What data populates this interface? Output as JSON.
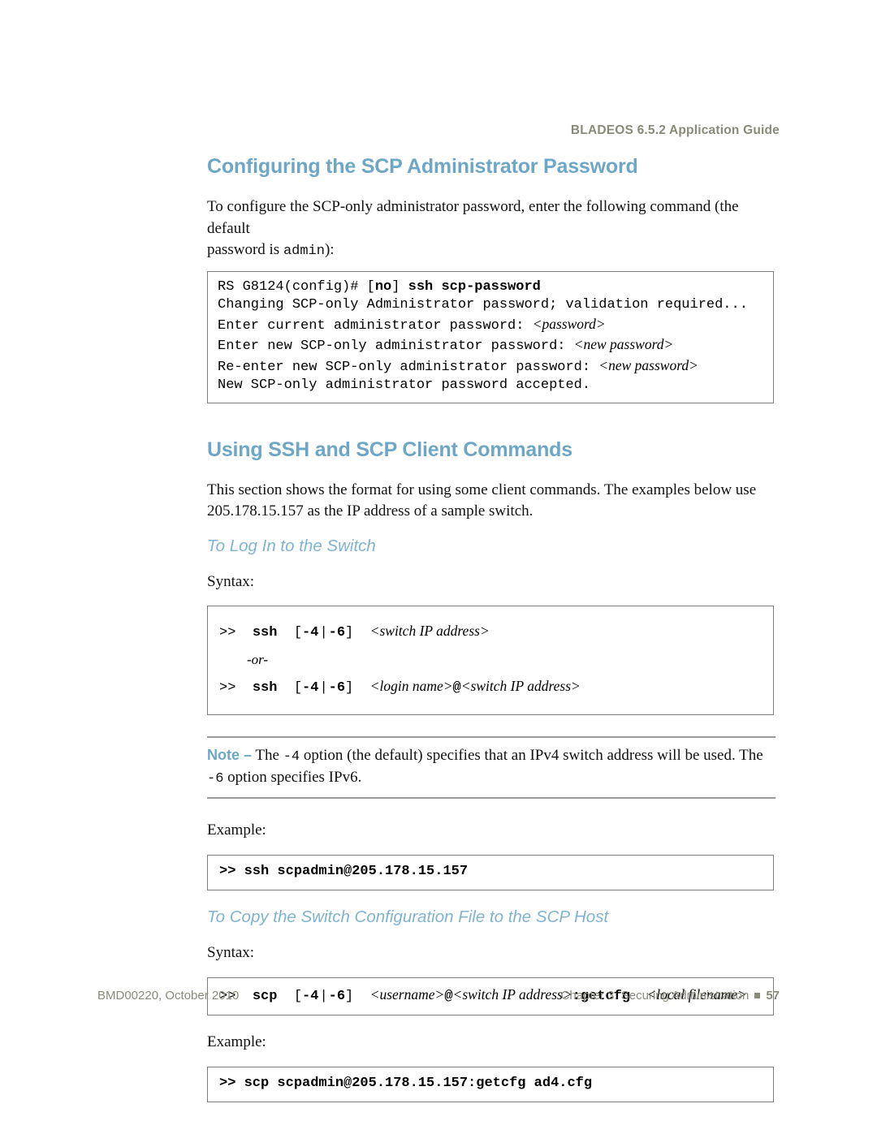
{
  "header": {
    "running_head": "BLADEOS 6.5.2 Application Guide"
  },
  "sections": [
    {
      "title": "Configuring the SCP Administrator Password",
      "intro_line1": "To configure the SCP-only administrator password, enter the following command (the default",
      "intro_line2_pre": "password is ",
      "intro_line2_mono": "admin",
      "intro_line2_post": "):",
      "console": {
        "line1_prompt": "RS G8124(config)# [",
        "line1_no": "no",
        "line1_bracket": "] ",
        "line1_cmd": "ssh scp-password",
        "line2": "Changing SCP-only Administrator password; validation required...",
        "line3_label": "Enter current administrator password: ",
        "line3_var": "<password>",
        "line4_label": "Enter new SCP-only administrator password: ",
        "line4_var": "<new password>",
        "line5_label": "Re-enter new SCP-only administrator password: ",
        "line5_var": "<new password>",
        "line6": "New SCP-only administrator password accepted."
      }
    },
    {
      "title": "Using SSH and SCP Client Commands",
      "intro_line1": "This section shows the format for using some client commands. The examples below use",
      "intro_line2": "205.178.15.157 as the IP address of a sample switch."
    }
  ],
  "subsections": [
    {
      "title": "To Log In to the Switch",
      "syntax_label": "Syntax:",
      "syntax_box": {
        "line1_prompt": ">>",
        "line1_cmd": "ssh",
        "line1_opt_open": "[",
        "line1_opt_4": "-4",
        "line1_opt_pipe": "|",
        "line1_opt_6": "-6",
        "line1_opt_close": "]",
        "line1_var": "<switch IP address>",
        "or_text": "-or-",
        "line3_prompt": ">>",
        "line3_cmd": "ssh",
        "line3_var_login": "<login name>",
        "line3_at": "@",
        "line3_var_addr": "<switch IP address>"
      },
      "note": {
        "label": "Note –",
        "text_a": " The ",
        "opt_4": "-4",
        "text_b": " option (the default) specifies that an IPv4 switch address will be used. The ",
        "opt_6": "-6",
        "text_c": " option specifies IPv6."
      },
      "example_label": "Example:",
      "example_code": ">> ssh scpadmin@205.178.15.157"
    },
    {
      "title": "To Copy the Switch Configuration File to the SCP Host",
      "syntax_label": "Syntax:",
      "syntax_box": {
        "prompt": ">>",
        "cmd": "scp",
        "opt_open": "[",
        "opt_4": "-4",
        "opt_pipe": "|",
        "opt_6": "-6",
        "opt_close": "]",
        "var_user": "<username>",
        "at": "@",
        "var_addr": "<switch IP address>",
        "colon_getcfg": ":getcfg",
        "var_file": "<local filename>"
      },
      "example_label": "Example:",
      "example_code": ">> scp scpadmin@205.178.15.157:getcfg ad4.cfg"
    }
  ],
  "footer": {
    "left": "BMD00220, October 2010",
    "chapter": "Chapter 3: Securing Administration",
    "page_number": "57"
  },
  "colors": {
    "heading_blue": "#6ea7c6",
    "subheading_blue": "#7fb3d0",
    "footer_gray": "#8a8a7a",
    "box_border": "#7c7c7c"
  }
}
